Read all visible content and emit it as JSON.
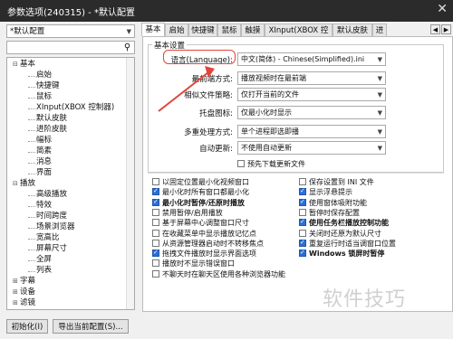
{
  "window": {
    "title": "参数选项(240315) - *默认配置",
    "close_glyph": "✕"
  },
  "left": {
    "preset": "*默认配置",
    "search_icon": "magnifier-icon",
    "tree": [
      {
        "label": "基本",
        "level": 0,
        "expanded": true
      },
      {
        "label": "启始",
        "level": 1
      },
      {
        "label": "快捷键",
        "level": 1
      },
      {
        "label": "鼠标",
        "level": 1
      },
      {
        "label": "XInput(XBOX 控制器)",
        "level": 1
      },
      {
        "label": "默认皮肤",
        "level": 1
      },
      {
        "label": "进阶皮肤",
        "level": 1
      },
      {
        "label": "幅标",
        "level": 1
      },
      {
        "label": "简素",
        "level": 1
      },
      {
        "label": "消息",
        "level": 1
      },
      {
        "label": "界面",
        "level": 1
      },
      {
        "label": "播放",
        "level": 0,
        "expanded": true
      },
      {
        "label": "高级播放",
        "level": 1
      },
      {
        "label": "特效",
        "level": 1
      },
      {
        "label": "时间跨度",
        "level": 1
      },
      {
        "label": "场景浏览器",
        "level": 1
      },
      {
        "label": "宽高比",
        "level": 1
      },
      {
        "label": "屏幕尺寸",
        "level": 1
      },
      {
        "label": "全屏",
        "level": 1
      },
      {
        "label": "列表",
        "level": 1
      },
      {
        "label": "字幕",
        "level": 0,
        "expanded": false
      },
      {
        "label": "设备",
        "level": 0,
        "expanded": false
      },
      {
        "label": "滤镜",
        "level": 0,
        "expanded": false
      }
    ],
    "buttons": {
      "reset": "初始化(I)",
      "export": "导出当前配置(S)..."
    }
  },
  "tabs": [
    "基本",
    "启始",
    "快捷键",
    "鼠标",
    "触摸",
    "XInput(XBOX 控制器)",
    "默认皮肤",
    "进"
  ],
  "active_tab": 0,
  "basic": {
    "group_title": "基本设置",
    "fields": [
      {
        "label": "语言(Language):",
        "value": "中文(简体) - Chinese(Simplified).ini"
      },
      {
        "label": "最前端方式:",
        "value": "播放视频时在最前端"
      },
      {
        "label": "相似文件策略:",
        "value": "仅打开当前的文件"
      },
      {
        "label": "托盘图标:",
        "value": "仅最小化时显示"
      },
      {
        "label": "多重处理方式:",
        "value": "单个进程即选即播"
      },
      {
        "label": "自动更新:",
        "value": "不使用自动更新"
      }
    ],
    "predownload": "预先下载更新文件",
    "checks_left": [
      {
        "label": "以固定位置最小化视频窗口",
        "on": false,
        "bold": false
      },
      {
        "label": "最小化时所有窗口都最小化",
        "on": true,
        "bold": false
      },
      {
        "label": "最小化时暂停/还原时播放",
        "on": true,
        "bold": true
      },
      {
        "label": "禁用暂停/启用播放",
        "on": false,
        "bold": false
      },
      {
        "label": "基于屏幕中心调整窗口尺寸",
        "on": false,
        "bold": false
      },
      {
        "label": "在收藏菜单中显示播放记忆点",
        "on": false,
        "bold": false
      },
      {
        "label": "从资源管理器启动时不转移焦点",
        "on": false,
        "bold": false
      },
      {
        "label": "拖拽文件播放时显示界面选项",
        "on": true,
        "bold": false
      },
      {
        "label": "播放时不显示错误窗口",
        "on": false,
        "bold": false
      },
      {
        "label": "不聊天时在聊天区使用各种浏览器功能",
        "on": false,
        "bold": false
      }
    ],
    "checks_right": [
      {
        "label": "保存设置到 INI 文件",
        "on": false,
        "bold": false
      },
      {
        "label": "显示浮悬提示",
        "on": true,
        "bold": false
      },
      {
        "label": "使用窗体吸附功能",
        "on": true,
        "bold": false
      },
      {
        "label": "暂停时保存配置",
        "on": false,
        "bold": false
      },
      {
        "label": "使用任务栏播放控制功能",
        "on": true,
        "bold": true
      },
      {
        "label": "关闭时还原为默认尺寸",
        "on": false,
        "bold": false
      },
      {
        "label": "重复运行时适当调窗口位置",
        "on": true,
        "bold": false
      },
      {
        "label": "Windows 锁屏时暂停",
        "on": true,
        "bold": true
      }
    ]
  },
  "watermark": "软件技巧",
  "colors": {
    "highlight": "#e0453a",
    "check_on": "#2b6fd6"
  }
}
